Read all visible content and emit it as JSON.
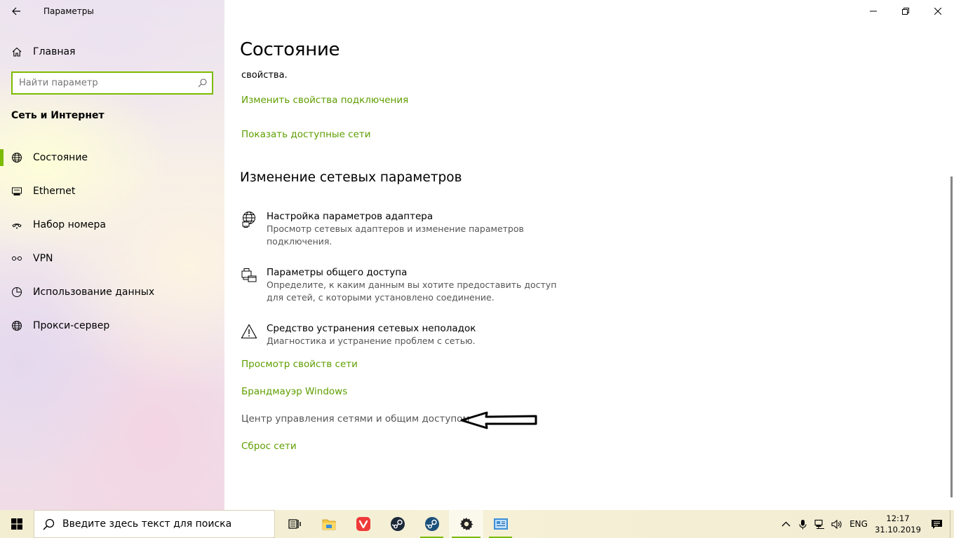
{
  "window": {
    "title": "Параметры"
  },
  "sidebar": {
    "home_label": "Главная",
    "search_placeholder": "Найти параметр",
    "section_title": "Сеть и Интернет",
    "items": [
      {
        "label": "Состояние",
        "icon": "globe-icon",
        "active": true
      },
      {
        "label": "Ethernet",
        "icon": "ethernet-icon",
        "active": false
      },
      {
        "label": "Набор номера",
        "icon": "dialup-icon",
        "active": false
      },
      {
        "label": "VPN",
        "icon": "vpn-icon",
        "active": false
      },
      {
        "label": "Использование данных",
        "icon": "data-usage-icon",
        "active": false
      },
      {
        "label": "Прокси-сервер",
        "icon": "globe-icon",
        "active": false
      }
    ]
  },
  "main": {
    "title": "Состояние",
    "clipped_text": "свойства.",
    "links_top": [
      "Изменить свойства подключения",
      "Показать доступные сети"
    ],
    "subheading": "Изменение сетевых параметров",
    "settings": [
      {
        "title": "Настройка параметров адаптера",
        "desc": "Просмотр сетевых адаптеров и изменение параметров подключения.",
        "icon": "adapter-icon"
      },
      {
        "title": "Параметры общего доступа",
        "desc": "Определите, к каким данным вы хотите предоставить доступ для сетей, с которыми установлено соединение.",
        "icon": "sharing-icon"
      },
      {
        "title": "Средство устранения сетевых неполадок",
        "desc": "Диагностика и устранение проблем с сетью.",
        "icon": "warning-icon"
      }
    ],
    "links_bottom": [
      "Просмотр свойств сети",
      "Брандмауэр Windows",
      "Центр управления сетями и общим доступом",
      "Сброс сети"
    ]
  },
  "taskbar": {
    "search_placeholder": "Введите здесь текст для поиска",
    "apps": [
      {
        "name": "task-view-icon"
      },
      {
        "name": "file-explorer-icon"
      },
      {
        "name": "vivaldi-icon"
      },
      {
        "name": "steam-icon"
      },
      {
        "name": "steam-icon"
      },
      {
        "name": "settings-gear-icon"
      },
      {
        "name": "control-panel-icon"
      }
    ],
    "language": "ENG",
    "time": "12:17",
    "date": "31.10.2019"
  },
  "colors": {
    "accent": "#7cbb00",
    "link": "#5e9e00",
    "inactive_link": "#555555"
  }
}
